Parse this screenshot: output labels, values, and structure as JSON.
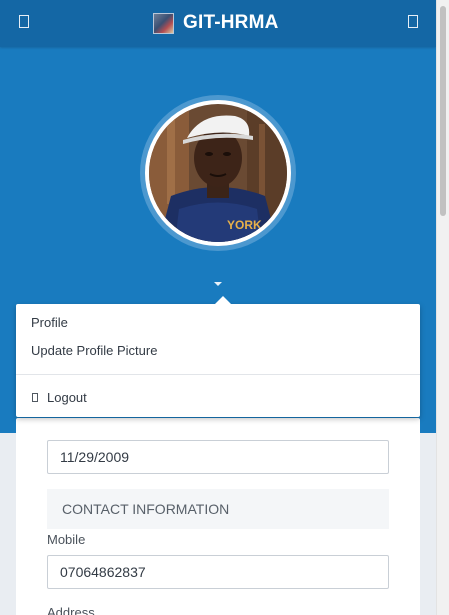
{
  "navbar": {
    "brand": "GIT-HRMA",
    "menu_icon_left": "sidebar-toggle-icon",
    "menu_icon_right": "menu-toggle-icon"
  },
  "profile_menu": {
    "items": [
      {
        "label": "Profile"
      },
      {
        "label": "Update Profile Picture"
      }
    ],
    "logout_label": "Logout",
    "logout_icon": "logout-icon"
  },
  "form": {
    "date_value": "11/29/2009",
    "contact_section_title": "CONTACT INFORMATION",
    "mobile_label": "Mobile",
    "mobile_value": "07064862837",
    "address_label": "Address"
  },
  "colors": {
    "navbar": "#1467a5",
    "hero": "#197bbf",
    "page_background": "#e9edf2"
  }
}
